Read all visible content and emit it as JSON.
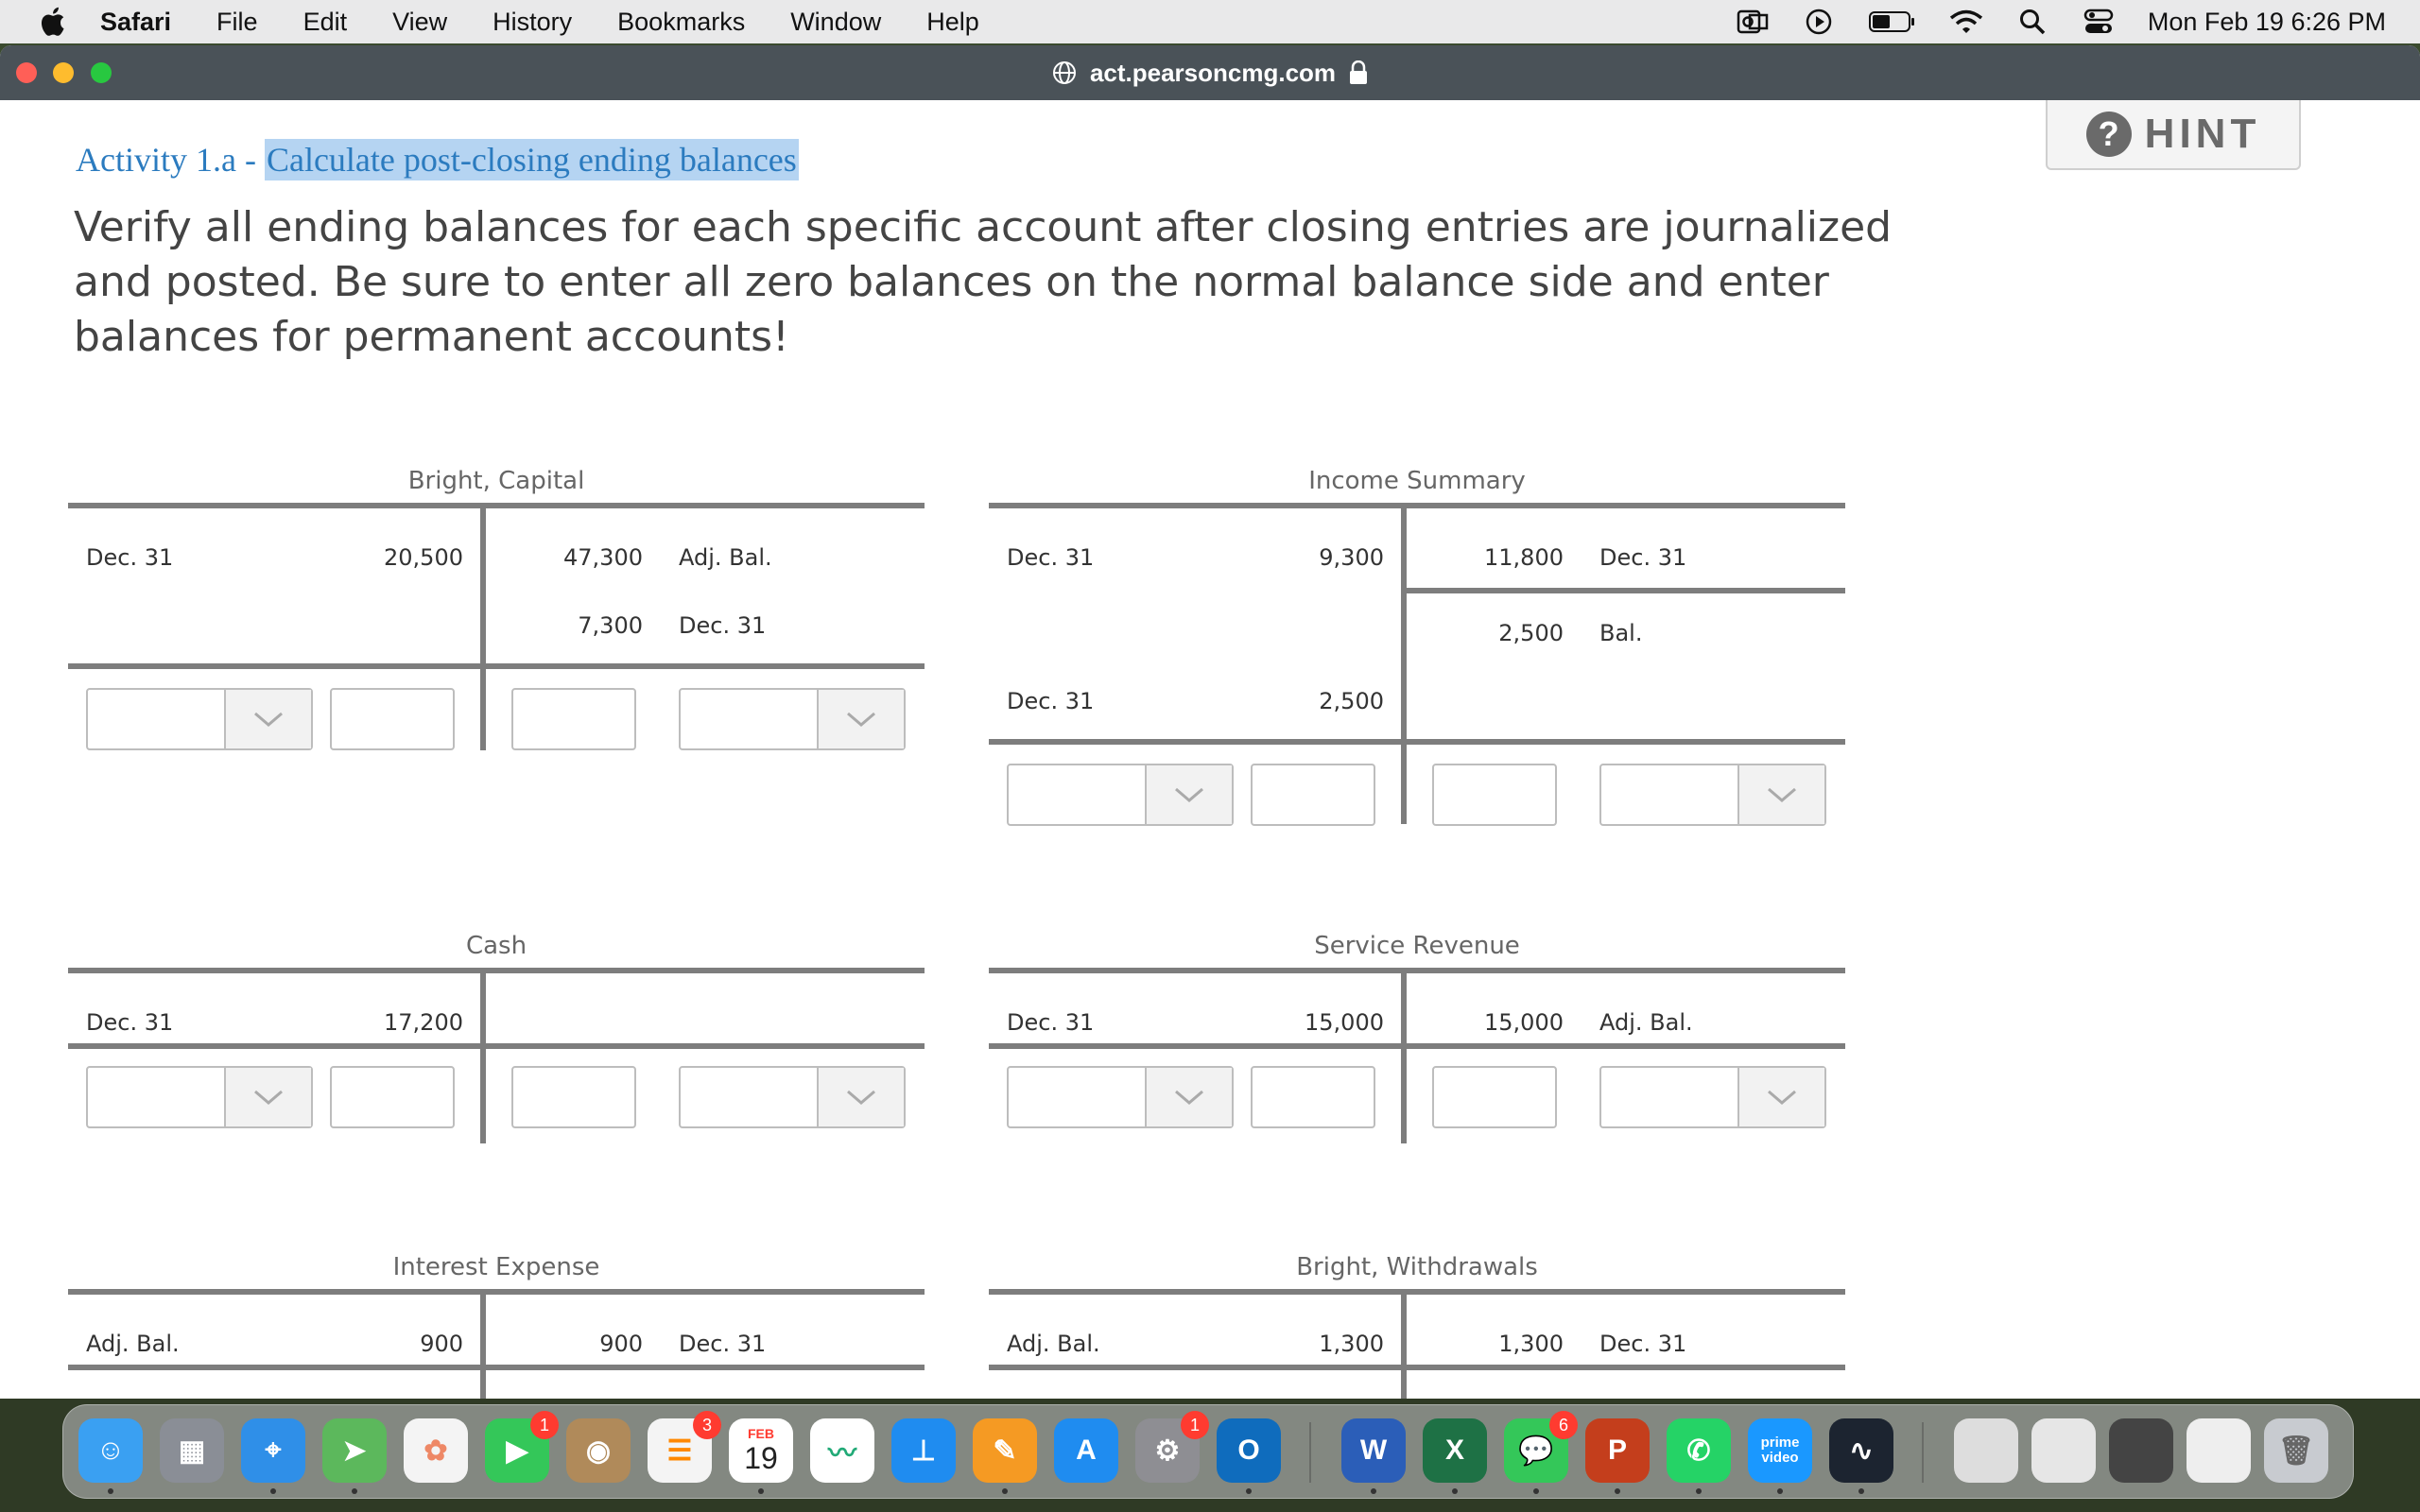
{
  "menubar": {
    "app_name": "Safari",
    "items": [
      "File",
      "Edit",
      "View",
      "History",
      "Bookmarks",
      "Window",
      "Help"
    ],
    "clock": "Mon Feb 19  6:26 PM"
  },
  "browser": {
    "url": "act.pearsoncmg.com"
  },
  "page": {
    "hint_label": "HINT",
    "activity_prefix": "Activity 1.a - ",
    "activity_title": "Calculate post-closing ending balances",
    "instructions": "Verify all ending balances for each specific account after closing entries are journalized and posted. Be sure to enter all zero balances on the normal balance side and enter balances for permanent accounts!"
  },
  "accounts": {
    "capital": {
      "title": "Bright, Capital",
      "r1": {
        "dl": "Dec. 31",
        "dv": "20,500",
        "cv": "47,300",
        "cl": "Adj. Bal."
      },
      "r2": {
        "cv": "7,300",
        "cl": "Dec. 31"
      }
    },
    "income": {
      "title": "Income Summary",
      "r1": {
        "dl": "Dec. 31",
        "dv": "9,300",
        "cv": "11,800",
        "cl": "Dec. 31"
      },
      "r2": {
        "cv": "2,500",
        "cl": "Bal."
      },
      "r3": {
        "dl": "Dec. 31",
        "dv": "2,500"
      }
    },
    "cash": {
      "title": "Cash",
      "r1": {
        "dl": "Dec. 31",
        "dv": "17,200"
      }
    },
    "revenue": {
      "title": "Service Revenue",
      "r1": {
        "dl": "Dec. 31",
        "dv": "15,000",
        "cv": "15,000",
        "cl": "Adj. Bal."
      }
    },
    "interest": {
      "title": "Interest Expense",
      "r1": {
        "dl": "Adj. Bal.",
        "dv": "900",
        "cv": "900",
        "cl": "Dec. 31"
      }
    },
    "withdrawals": {
      "title": "Bright, Withdrawals",
      "r1": {
        "dl": "Adj. Bal.",
        "dv": "1,300",
        "cv": "1,300",
        "cl": "Dec. 31"
      }
    }
  },
  "dock": {
    "calendar_month": "FEB",
    "calendar_day": "19",
    "badges": {
      "facetime": "1",
      "reminders": "3",
      "settings": "1",
      "messages": "6"
    },
    "prime_label": "prime video"
  },
  "colors": {
    "title_blue": "#2b7bbf",
    "highlight": "#b5d4f2",
    "tline_gray": "#7d7d7d",
    "titlebar": "#4a5258"
  }
}
